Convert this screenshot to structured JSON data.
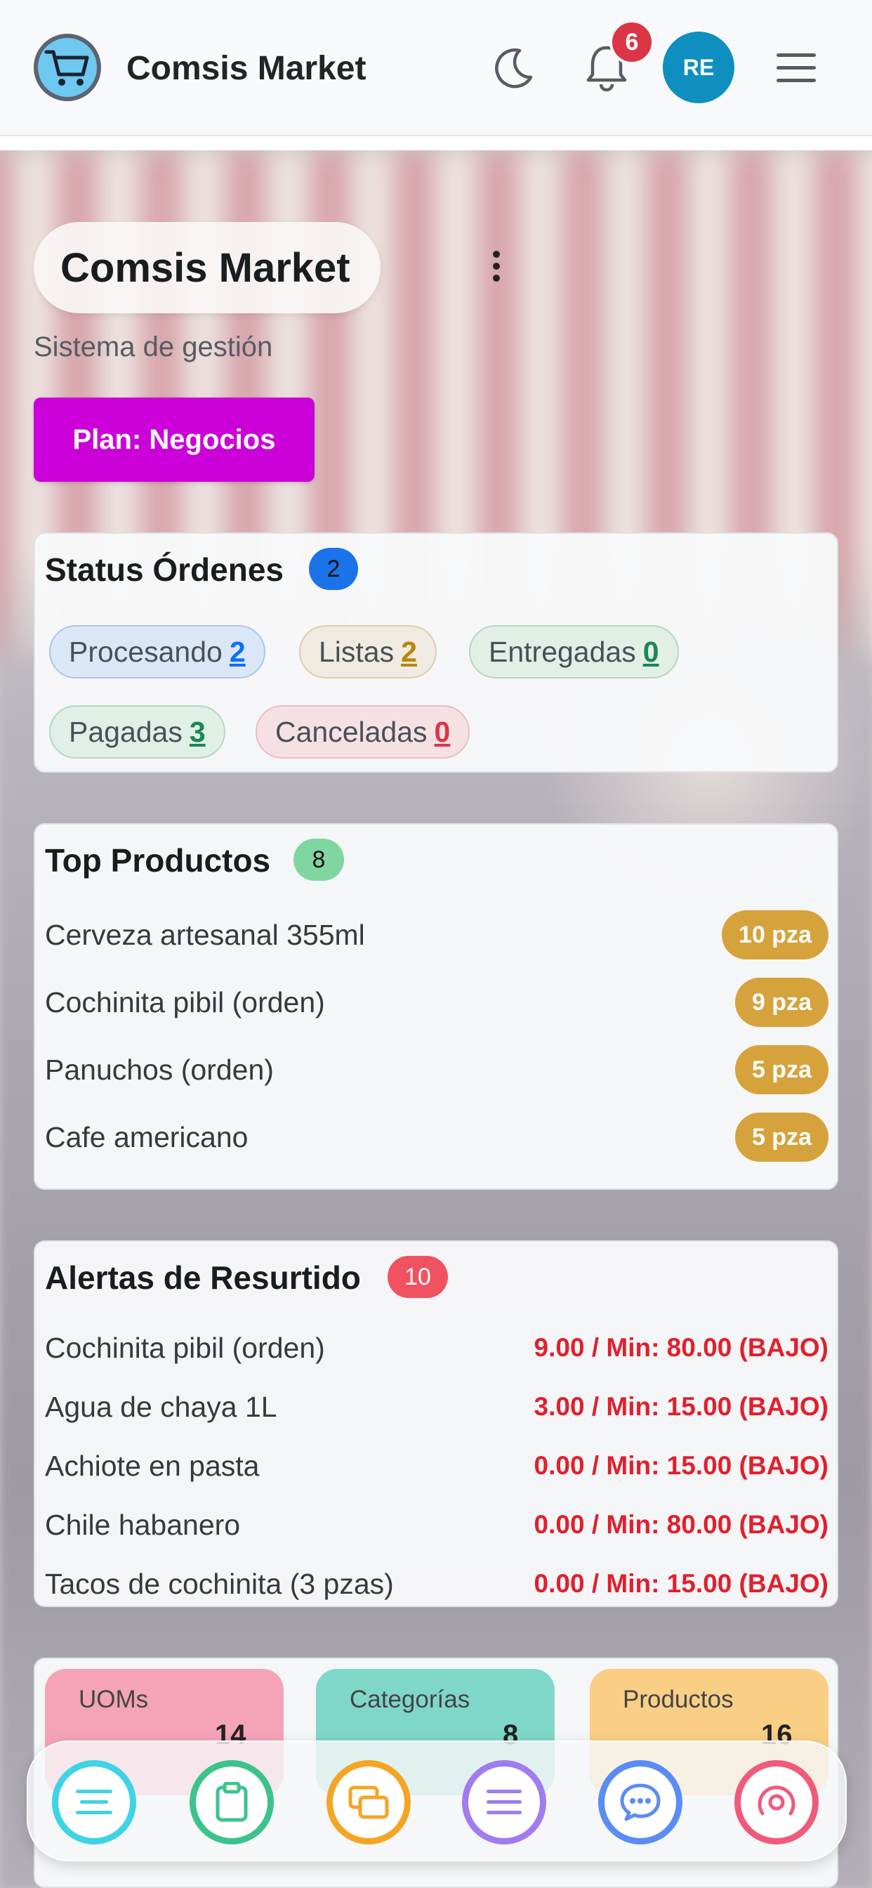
{
  "header": {
    "app_title": "Comsis Market",
    "notification_count": "6",
    "avatar_initials": "RE",
    "icons": [
      "cart-logo-icon",
      "moon-icon",
      "bell-icon",
      "menu-icon"
    ]
  },
  "hero": {
    "title": "Comsis Market",
    "subtitle": "Sistema de gestión",
    "plan_button": "Plan: Negocios"
  },
  "status_orders": {
    "title": "Status Órdenes",
    "count": "2",
    "pills": [
      {
        "label": "Procesando",
        "value": "2",
        "color": "#0d6efd"
      },
      {
        "label": "Listas",
        "value": "2",
        "color": "#b8860b"
      },
      {
        "label": "Entregadas",
        "value": "0",
        "color": "#198754"
      },
      {
        "label": "Pagadas",
        "value": "3",
        "color": "#198754"
      },
      {
        "label": "Canceladas",
        "value": "0",
        "color": "#dc3545"
      }
    ]
  },
  "top_products": {
    "title": "Top Productos",
    "count": "8",
    "items": [
      {
        "name": "Cerveza artesanal 355ml",
        "qty": "10 pza"
      },
      {
        "name": "Cochinita pibil (orden)",
        "qty": "9 pza"
      },
      {
        "name": "Panuchos (orden)",
        "qty": "5 pza"
      },
      {
        "name": "Cafe americano",
        "qty": "5 pza"
      }
    ]
  },
  "restock_alerts": {
    "title": "Alertas de Resurtido",
    "count": "10",
    "items": [
      {
        "name": "Cochinita pibil (orden)",
        "value": "9.00 / Min: 80.00 (BAJO)"
      },
      {
        "name": "Agua de chaya 1L",
        "value": "3.00 / Min: 15.00 (BAJO)"
      },
      {
        "name": "Achiote en pasta",
        "value": "0.00 / Min: 15.00 (BAJO)"
      },
      {
        "name": "Chile habanero",
        "value": "0.00 / Min: 80.00 (BAJO)"
      },
      {
        "name": "Tacos de cochinita (3 pzas)",
        "value": "0.00 / Min: 15.00 (BAJO)"
      }
    ]
  },
  "stats": [
    {
      "label": "UOMs",
      "value": "14",
      "color": "#f4a3b8"
    },
    {
      "label": "Categorías",
      "value": "8",
      "color": "#7fd7c8"
    },
    {
      "label": "Productos",
      "value": "16",
      "color": "#f9cf85"
    }
  ],
  "bottom_nav": [
    {
      "icon": "lines-icon",
      "color": "#3fd3e6"
    },
    {
      "icon": "clipboard-icon",
      "color": "#3cc38c"
    },
    {
      "icon": "layers-icon",
      "color": "#f5a524"
    },
    {
      "icon": "list-icon",
      "color": "#a07cf0"
    },
    {
      "icon": "chat-icon",
      "color": "#5b8cf5"
    },
    {
      "icon": "target-icon",
      "color": "#f05a7a"
    }
  ]
}
